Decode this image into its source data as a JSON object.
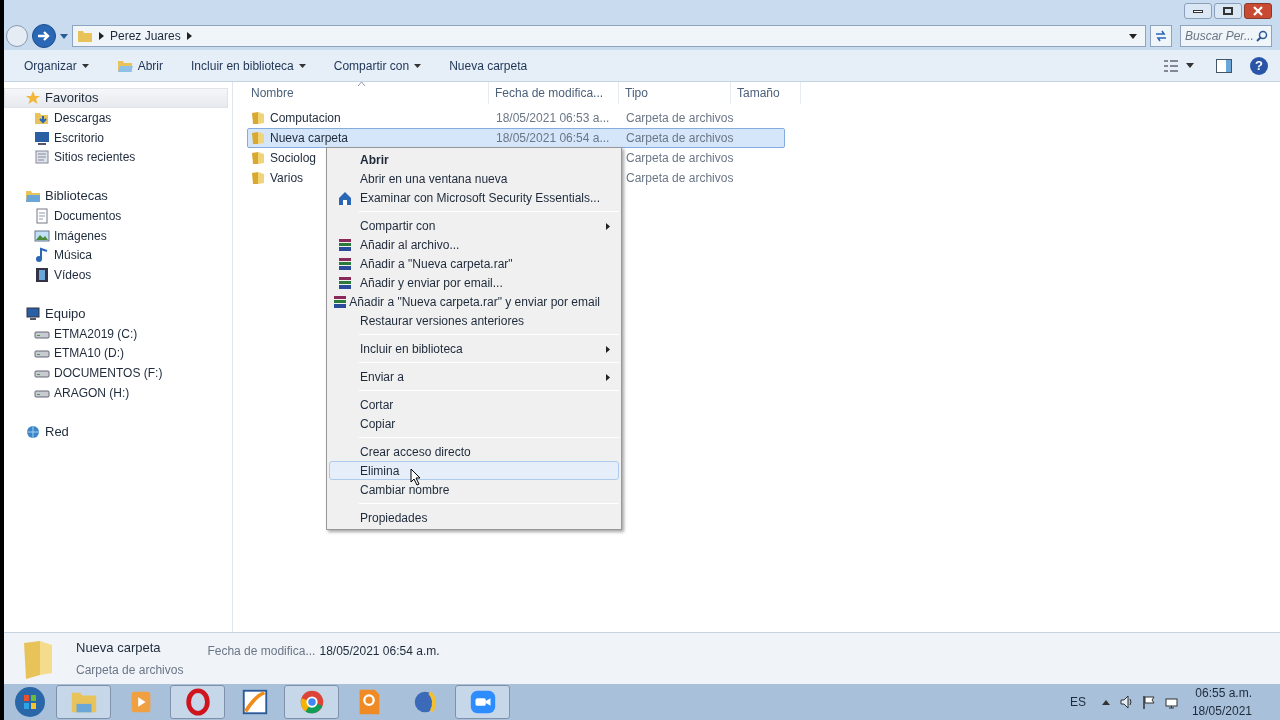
{
  "address_bar": {
    "crumbs": [
      "Perez Juares"
    ]
  },
  "search": {
    "placeholder": "Buscar Per..."
  },
  "toolbar": [
    {
      "label": "Organizar",
      "dropdown": true
    },
    {
      "label": "Abrir",
      "dropdown": false
    },
    {
      "label": "Incluir en biblioteca",
      "dropdown": true
    },
    {
      "label": "Compartir con",
      "dropdown": true
    },
    {
      "label": "Nueva carpeta",
      "dropdown": false
    }
  ],
  "help_button": "?",
  "sidebar": {
    "items": [
      {
        "label": "Favoritos",
        "selected": true,
        "children": [
          {
            "label": "Descargas",
            "selected": false
          },
          {
            "label": "Escritorio",
            "selected": false
          },
          {
            "label": "Sitios recientes",
            "selected": false
          }
        ]
      },
      {
        "label": "Bibliotecas",
        "selected": false,
        "children": [
          {
            "label": "Documentos",
            "selected": false
          },
          {
            "label": "Imágenes",
            "selected": false
          },
          {
            "label": "Música",
            "selected": false
          },
          {
            "label": "Vídeos",
            "selected": false
          }
        ]
      },
      {
        "label": "Equipo",
        "selected": false,
        "children": [
          {
            "label": "ETMA2019 (C:)",
            "selected": false
          },
          {
            "label": "ETMA10 (D:)",
            "selected": false
          },
          {
            "label": "DOCUMENTOS (F:)",
            "selected": false
          },
          {
            "label": "ARAGON (H:)",
            "selected": false
          }
        ]
      },
      {
        "label": "Red",
        "selected": false
      }
    ]
  },
  "table": {
    "columns": [
      "Nombre",
      "Fecha de modifica...",
      "Tipo",
      "Tamaño"
    ],
    "rows": [
      {
        "name": "Computacion",
        "date": "18/05/2021 06:53 a...",
        "type": "Carpeta de archivos",
        "selected": false
      },
      {
        "name": "Nueva carpeta",
        "date": "18/05/2021 06:54 a...",
        "type": "Carpeta de archivos",
        "selected": true
      },
      {
        "name": "Sociolog",
        "type": "Carpeta de archivos",
        "selected": false
      },
      {
        "name": "Varios",
        "type": "Carpeta de archivos",
        "selected": false
      }
    ]
  },
  "context_menu": [
    {
      "kind": "item",
      "label": "Abrir",
      "default": true,
      "submenu": false,
      "selected": false
    },
    {
      "kind": "item",
      "label": "Abrir en una ventana nueva",
      "default": false,
      "submenu": false,
      "selected": false
    },
    {
      "kind": "item",
      "label": "Examinar con Microsoft Security Essentials...",
      "default": false,
      "submenu": false,
      "selected": false
    },
    {
      "kind": "separator"
    },
    {
      "kind": "item",
      "label": "Compartir con",
      "default": false,
      "submenu": true,
      "selected": false
    },
    {
      "kind": "item",
      "label": "Añadir al archivo...",
      "default": false,
      "submenu": false,
      "selected": false
    },
    {
      "kind": "item",
      "label": "Añadir a \"Nueva carpeta.rar\"",
      "default": false,
      "submenu": false,
      "selected": false
    },
    {
      "kind": "item",
      "label": "Añadir y enviar por email...",
      "default": false,
      "submenu": false,
      "selected": false
    },
    {
      "kind": "item",
      "label": "Añadir a \"Nueva carpeta.rar\" y enviar por email",
      "default": false,
      "submenu": false,
      "selected": false
    },
    {
      "kind": "item",
      "label": "Restaurar versiones anteriores",
      "default": false,
      "submenu": false,
      "selected": false
    },
    {
      "kind": "separator"
    },
    {
      "kind": "item",
      "label": "Incluir en biblioteca",
      "default": false,
      "submenu": true,
      "selected": false
    },
    {
      "kind": "separator"
    },
    {
      "kind": "item",
      "label": "Enviar a",
      "default": false,
      "submenu": true,
      "selected": false
    },
    {
      "kind": "separator"
    },
    {
      "kind": "item",
      "label": "Cortar",
      "default": false,
      "submenu": false,
      "selected": false
    },
    {
      "kind": "item",
      "label": "Copiar",
      "default": false,
      "submenu": false,
      "selected": false
    },
    {
      "kind": "separator"
    },
    {
      "kind": "item",
      "label": "Crear acceso directo",
      "default": false,
      "submenu": false,
      "selected": false
    },
    {
      "kind": "item",
      "label": "Elimina",
      "default": false,
      "submenu": false,
      "selected": true
    },
    {
      "kind": "item",
      "label": "Cambiar nombre",
      "default": false,
      "submenu": false,
      "selected": false
    },
    {
      "kind": "separator"
    },
    {
      "kind": "item",
      "label": "Propiedades",
      "default": false,
      "submenu": false,
      "selected": false
    }
  ],
  "details_pane": {
    "name": "Nueva carpeta",
    "type": "Carpeta de archivos",
    "field_label": "Fecha de modifica...",
    "field_value": "18/05/2021 06:54 a.m."
  },
  "taskbar": {
    "apps": [
      {
        "selected": true
      },
      {
        "selected": false
      },
      {
        "selected": true
      },
      {
        "selected": false
      },
      {
        "selected": true
      },
      {
        "selected": false
      },
      {
        "selected": false
      },
      {
        "selected": true
      }
    ],
    "language": "ES",
    "time": "06:55 a.m.",
    "date": "18/05/2021"
  }
}
